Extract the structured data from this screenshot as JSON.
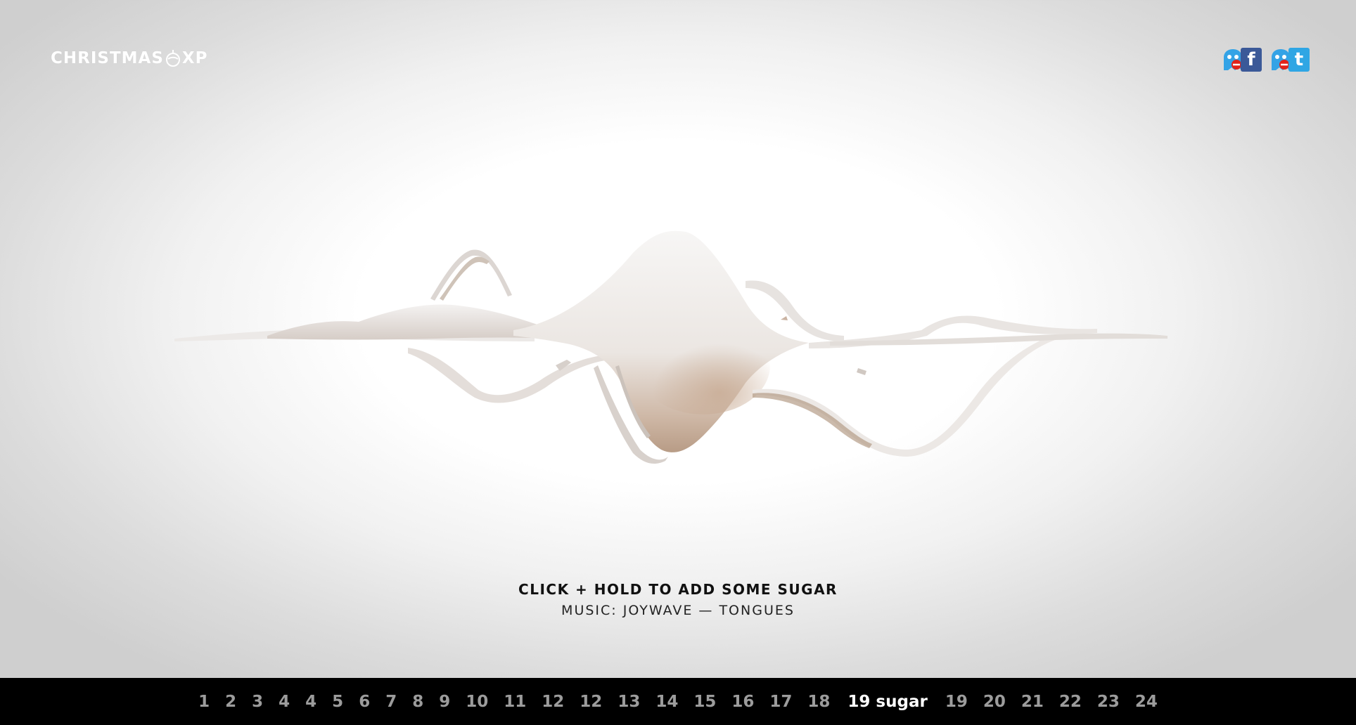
{
  "logo": {
    "text_left": "CHRISTMAS",
    "text_right": "XP",
    "ornament_icon": "bauble-icon"
  },
  "social": {
    "facebook": {
      "icon": "facebook-ghost-icon",
      "letter": "f",
      "color": "#3b5998"
    },
    "twitter": {
      "icon": "twitter-ghost-icon",
      "letter": "t",
      "color": "#2fa6e4"
    }
  },
  "scene": {
    "instruction": "CLICK + HOLD TO ADD SOME SUGAR",
    "music": "MUSIC: JOYWAVE — TONGUES"
  },
  "day_nav": {
    "items": [
      {
        "label": "1",
        "active": false
      },
      {
        "label": "2",
        "active": false
      },
      {
        "label": "3",
        "active": false
      },
      {
        "label": "4",
        "active": false
      },
      {
        "label": "4",
        "active": false
      },
      {
        "label": "5",
        "active": false
      },
      {
        "label": "6",
        "active": false
      },
      {
        "label": "7",
        "active": false
      },
      {
        "label": "8",
        "active": false
      },
      {
        "label": "9",
        "active": false
      },
      {
        "label": "10",
        "active": false
      },
      {
        "label": "11",
        "active": false
      },
      {
        "label": "12",
        "active": false
      },
      {
        "label": "12",
        "active": false
      },
      {
        "label": "13",
        "active": false
      },
      {
        "label": "14",
        "active": false
      },
      {
        "label": "15",
        "active": false
      },
      {
        "label": "16",
        "active": false
      },
      {
        "label": "17",
        "active": false
      },
      {
        "label": "18",
        "active": false
      },
      {
        "label": "19 sugar",
        "active": true
      },
      {
        "label": "19",
        "active": false
      },
      {
        "label": "20",
        "active": false
      },
      {
        "label": "21",
        "active": false
      },
      {
        "label": "22",
        "active": false
      },
      {
        "label": "23",
        "active": false
      },
      {
        "label": "24",
        "active": false
      }
    ]
  },
  "colors": {
    "nav_background": "#000000",
    "nav_text": "#9c9c9c",
    "nav_active": "#ffffff",
    "sugar_shadow": "#c9a689"
  }
}
